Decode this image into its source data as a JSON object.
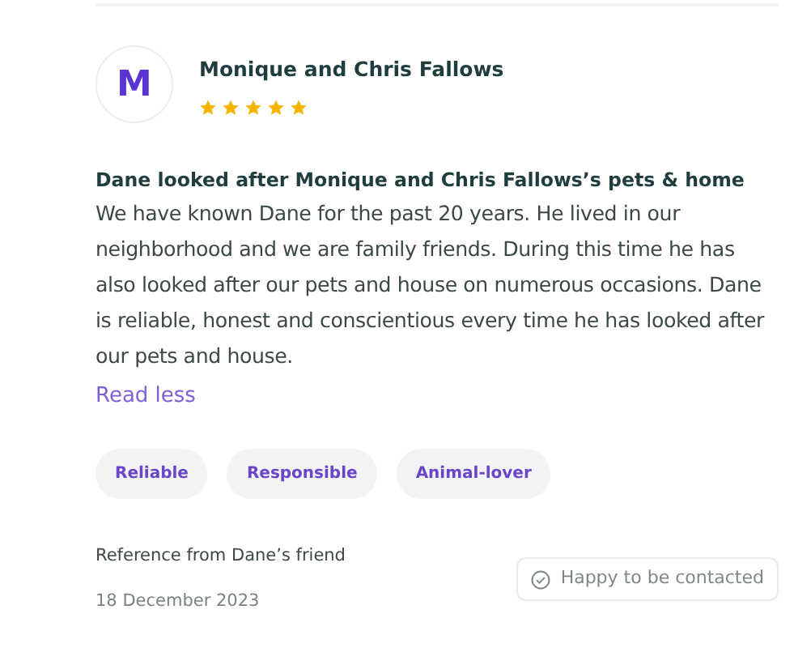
{
  "reviewer": {
    "initial": "M",
    "name": "Monique and Chris Fallows",
    "stars": 5
  },
  "headline": "Dane looked after Monique and Chris Fallows’s pets & home",
  "body": "We have known Dane for the past 20 years. He lived in our neighborhood and we are family friends. During this time he has also looked after our pets and house on numerous occasions. Dane is reliable, honest and conscientious every time he has looked after our pets and house.",
  "toggle_link": "Read less",
  "tags": [
    "Reliable",
    "Responsible",
    "Animal-lover"
  ],
  "reference": "Reference from Dane’s friend",
  "date": "18 December 2023",
  "contact_badge": {
    "label": "Happy to be contacted",
    "checked": true
  }
}
